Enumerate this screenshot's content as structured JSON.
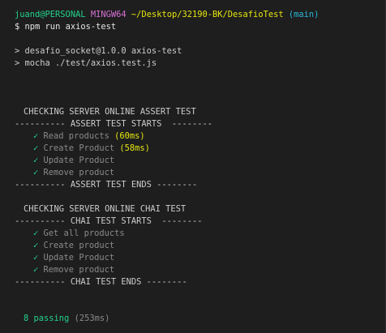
{
  "prompt": {
    "user": "juand@PERSONAL",
    "shell": "MINGW64",
    "path": "~/Desktop/32190-BK/DesafioTest",
    "branch": "(main)",
    "symbol": "$",
    "command": "npm run axios-test"
  },
  "npm_output": {
    "line1": "> desafio_socket@1.0.0 axios-test",
    "line2": "> mocha ./test/axios.test.js"
  },
  "assert_suite": {
    "title": "CHECKING SERVER ONLINE ASSERT TEST",
    "starts": "---------- ASSERT TEST STARTS  --------",
    "tests": [
      {
        "name": "Read products",
        "duration": "(60ms)"
      },
      {
        "name": "Create Product",
        "duration": "(58ms)"
      },
      {
        "name": "Update Product",
        "duration": ""
      },
      {
        "name": "Remove product",
        "duration": ""
      }
    ],
    "ends": "---------- ASSERT TEST ENDS --------"
  },
  "chai_suite": {
    "title": "CHECKING SERVER ONLINE CHAI TEST",
    "starts": "---------- CHAI TEST STARTS  --------",
    "tests": [
      {
        "name": "Get all products",
        "duration": ""
      },
      {
        "name": "Create product",
        "duration": ""
      },
      {
        "name": "Update Product",
        "duration": ""
      },
      {
        "name": "Remove product",
        "duration": ""
      }
    ],
    "ends": "---------- CHAI TEST ENDS --------"
  },
  "summary": {
    "passing": "8 passing",
    "time": "(253ms)"
  },
  "check_glyph": "✓",
  "colors": {
    "background": "#1e1e1e",
    "green": "#23d18b",
    "magenta": "#d670d6",
    "yellow": "#e5e510",
    "cyan": "#29b8db",
    "grey": "#8a8a8a"
  }
}
